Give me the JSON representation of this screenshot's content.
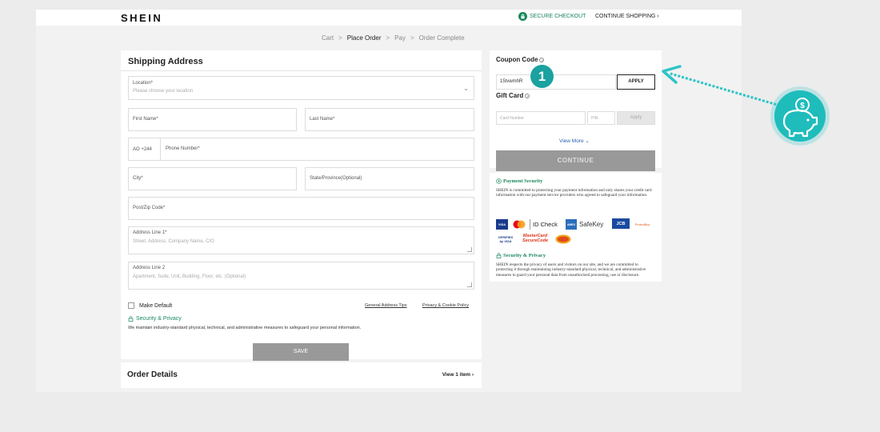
{
  "header": {
    "logo": "SHEIN",
    "secure_checkout": "SECURE CHECKOUT",
    "continue_shopping": "CONTINUE SHOPPING"
  },
  "breadcrumb": [
    "Cart",
    "Place Order",
    "Pay",
    "Order Complete"
  ],
  "shipping": {
    "title": "Shipping Address",
    "location_label": "Location*",
    "location_placeholder": "Please choose your location",
    "first_name": "First Name*",
    "last_name": "Last Name*",
    "phone_prefix": "AO +244",
    "phone_label": "Phone Number*",
    "city": "City*",
    "state": "State/Province(Optional)",
    "postal": "Post/Zip Code*",
    "address1_label": "Address Line 1*",
    "address1_placeholder": "Street, Address, Company Name, C/O",
    "address2_label": "Address Line 2",
    "address2_placeholder": "Apartment, Suite, Unit, Building, Floor, etc. (Optional)",
    "make_default": "Make Default",
    "general_tips": "General Address Tips",
    "privacy_policy": "Privacy & Cookie Policy",
    "security_title": "Security & Privacy",
    "security_text": "We maintain industry-standard physical, technical, and administrative measures to safeguard your personal information.",
    "save": "SAVE"
  },
  "order_details": {
    "title": "Order Details",
    "view_items": "View 1 item"
  },
  "coupon": {
    "title": "Coupon Code",
    "value": "15tvwmhR",
    "apply": "APPLY"
  },
  "gift_card": {
    "title": "Gift Card",
    "card_placeholder": "Card Number",
    "pin_placeholder": "PIN",
    "apply": "Apply",
    "view_more": "View More",
    "continue": "CONTINUE"
  },
  "payment_security": {
    "title": "Payment Security",
    "text": "SHEIN is committed to protecting your payment information and only shares your credit card information with our payment service providers who agreed to safeguard your information.",
    "logos": {
      "visa": "VISA",
      "id_check": "ID Check",
      "safekey": "SafeKey",
      "jcb": "JCB",
      "protectbuy": "ProtectBuy",
      "verified_visa": "VERIFIED by VISA",
      "mastercard_securecode": "MasterCard SecureCode"
    },
    "privacy_title": "Security & Privacy",
    "privacy_text": "SHEIN respects the privacy of users and visitors on our site, and we are committed to protecting it through maintaining industry-standard physical, technical, and administrative measures to guard your personal data from unauthorized processing, use or disclosure."
  },
  "annotation": {
    "step": "1",
    "icon": "piggy-bank-dollar-icon",
    "accent": "#1aa1a0"
  },
  "colors": {
    "green": "#19875c",
    "disabled_button": "#999999",
    "link_blue": "#2a5fb4"
  }
}
